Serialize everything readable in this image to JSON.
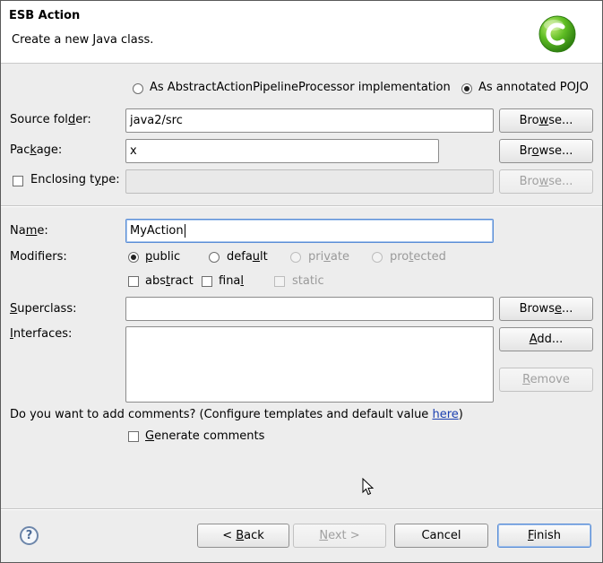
{
  "header": {
    "title": "ESB Action",
    "description": "Create a new Java class."
  },
  "implementation": {
    "option_abstract": "As AbstractActionPipelineProcessor implementation",
    "option_pojo": "As annotated POJO",
    "selected": "pojo"
  },
  "source_folder": {
    "label_pre": "Source fol",
    "label_u": "d",
    "label_post": "er:",
    "value": "java2/src"
  },
  "package": {
    "label_pre": "Pac",
    "label_u": "k",
    "label_post": "age:",
    "value": "x"
  },
  "enclosing": {
    "label_pre": "Enclosing t",
    "label_u": "y",
    "label_post": "pe:",
    "value": "",
    "checked": false
  },
  "name": {
    "label_pre": "Na",
    "label_u": "m",
    "label_post": "e:",
    "value": "MyAction"
  },
  "modifiers": {
    "label": "Modifiers:",
    "public_pre": "",
    "public_u": "p",
    "public_post": "ublic",
    "default_pre": "defa",
    "default_u": "u",
    "default_post": "lt",
    "private_pre": "pri",
    "private_u": "v",
    "private_post": "ate",
    "protected_pre": "pro",
    "protected_u": "t",
    "protected_post": "ected",
    "abstract_pre": "abs",
    "abstract_u": "t",
    "abstract_post": "ract",
    "final_pre": "fina",
    "final_u": "l",
    "final_post": "",
    "static_label": "static",
    "selected": "public"
  },
  "superclass": {
    "label_pre": "",
    "label_u": "S",
    "label_post": "uperclass:",
    "value": ""
  },
  "interfaces": {
    "label_pre": "",
    "label_u": "I",
    "label_post": "nterfaces:"
  },
  "buttons": {
    "browse_pre": "Bro",
    "browse_u": "w",
    "browse_post": "se...",
    "browse2_pre": "Br",
    "browse2_u": "o",
    "browse2_post": "wse...",
    "browse3_pre": "Bro",
    "browse3_u": "w",
    "browse3_post": "se...",
    "browse4_pre": "Brows",
    "browse4_u": "e",
    "browse4_post": "...",
    "add_pre": "",
    "add_u": "A",
    "add_post": "dd...",
    "remove_pre": "",
    "remove_u": "R",
    "remove_post": "emove"
  },
  "comments": {
    "question": "Do you want to add comments? (Configure templates and default value ",
    "link": "here",
    "question_end": ")",
    "generate_pre": "",
    "generate_u": "G",
    "generate_post": "enerate comments"
  },
  "footer": {
    "help": "?",
    "back_pre": "< ",
    "back_u": "B",
    "back_post": "ack",
    "next_pre": "",
    "next_u": "N",
    "next_post": "ext >",
    "cancel": "Cancel",
    "finish_pre": "",
    "finish_u": "F",
    "finish_post": "inish"
  },
  "colors": {
    "link": "#1a3fb0",
    "logo": "#4cae1e",
    "focus": "#5b8ed6"
  }
}
